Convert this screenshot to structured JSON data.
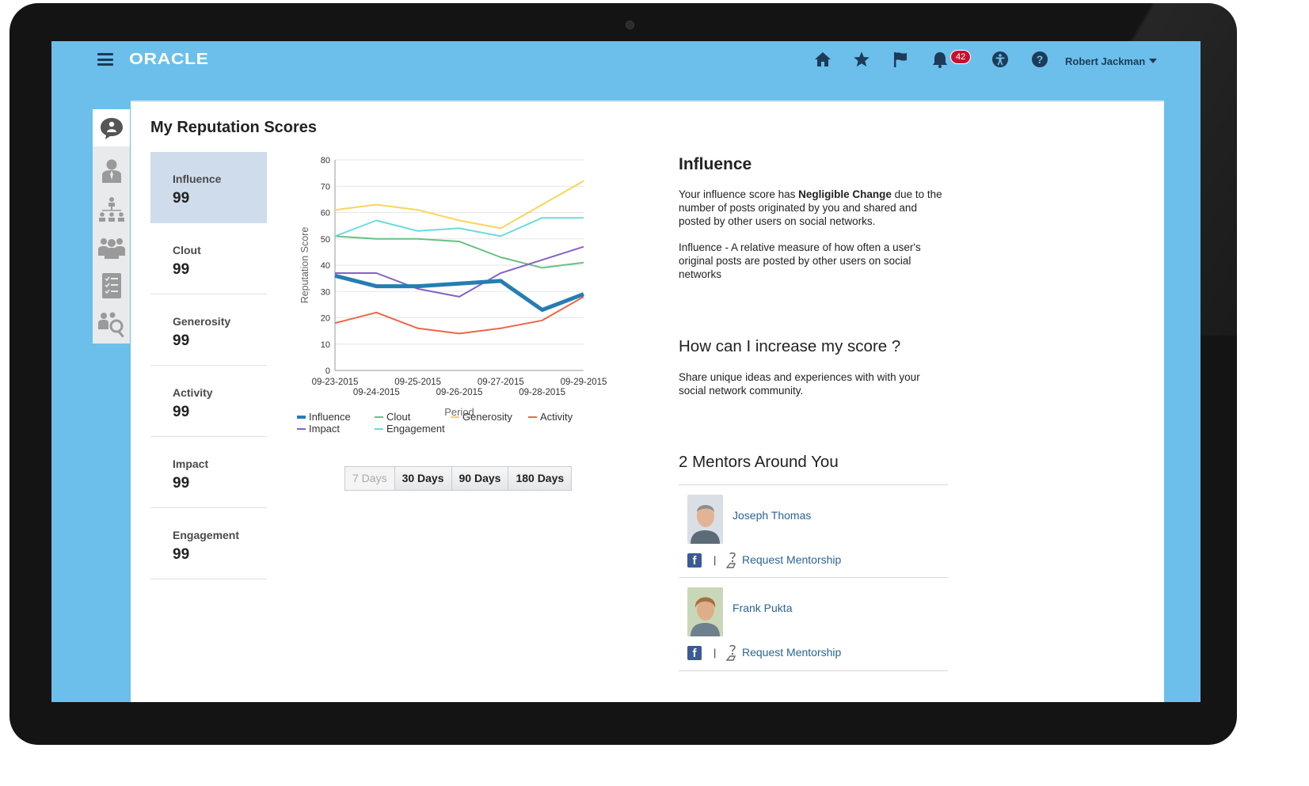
{
  "header": {
    "logo": "ORACLE",
    "notifications_count": "42",
    "user_name": "Robert Jackman",
    "icons": [
      "menu-icon",
      "home-icon",
      "star-icon",
      "flag-icon",
      "notification-icon",
      "accessibility-icon",
      "help-icon"
    ]
  },
  "rail": {
    "items": [
      "reputation-icon",
      "person-icon",
      "org-chart-icon",
      "team-icon",
      "checklist-icon",
      "people-search-icon"
    ]
  },
  "main": {
    "title": "My Reputation Scores",
    "scores": [
      {
        "label": "Influence",
        "value": "99"
      },
      {
        "label": "Clout",
        "value": "99"
      },
      {
        "label": "Generosity",
        "value": "99"
      },
      {
        "label": "Activity",
        "value": "99"
      },
      {
        "label": "Impact",
        "value": "99"
      },
      {
        "label": "Engagement",
        "value": "99"
      }
    ],
    "range_buttons": [
      "7 Days",
      "30 Days",
      "90 Days",
      "180 Days"
    ]
  },
  "chart_data": {
    "type": "line",
    "x": [
      "09-23-2015",
      "09-24-2015",
      "09-25-2015",
      "09-26-2015",
      "09-27-2015",
      "09-28-2015",
      "09-29-2015"
    ],
    "xlabel": "Period",
    "ylabel": "Reputation Score",
    "ylim": [
      0,
      80
    ],
    "yticks": [
      0,
      10,
      20,
      30,
      40,
      50,
      60,
      70,
      80
    ],
    "grid": true,
    "legend": "bottom",
    "series": [
      {
        "name": "Influence",
        "color": "#267db3",
        "values": [
          36,
          32,
          32,
          33,
          34,
          23,
          29
        ]
      },
      {
        "name": "Clout",
        "color": "#68c182",
        "values": [
          51,
          50,
          50,
          49,
          43,
          39,
          41
        ]
      },
      {
        "name": "Generosity",
        "color": "#fad55c",
        "values": [
          61,
          63,
          61,
          57,
          54,
          63,
          72
        ]
      },
      {
        "name": "Activity",
        "color": "#ed6647",
        "values": [
          18,
          22,
          16,
          14,
          16,
          19,
          28
        ]
      },
      {
        "name": "Impact",
        "color": "#8561c8",
        "values": [
          37,
          37,
          31,
          28,
          37,
          42,
          47
        ]
      },
      {
        "name": "Engagement",
        "color": "#6ddbdb",
        "values": [
          51,
          57,
          53,
          54,
          51,
          58,
          58
        ]
      }
    ]
  },
  "detail": {
    "heading": "Influence",
    "desc_pre": "Your influence score has ",
    "desc_bold": "Negligible Change",
    "desc_post": " due to the number of posts originated by you and shared and posted by other users on social networks.",
    "definition": "Influence - A relative measure of how often a user's original posts are posted by other users on social networks",
    "increase_heading": "How can I increase my score ?",
    "increase_text": "Share unique ideas and experiences with with your social network community.",
    "mentors_heading": "2 Mentors Around You",
    "mentors": [
      {
        "name": "Joseph Thomas",
        "facebook": "f",
        "separator": "|",
        "request": "Request Mentorship"
      },
      {
        "name": "Frank Pukta",
        "facebook": "f",
        "separator": "|",
        "request": "Request Mentorship"
      }
    ]
  }
}
